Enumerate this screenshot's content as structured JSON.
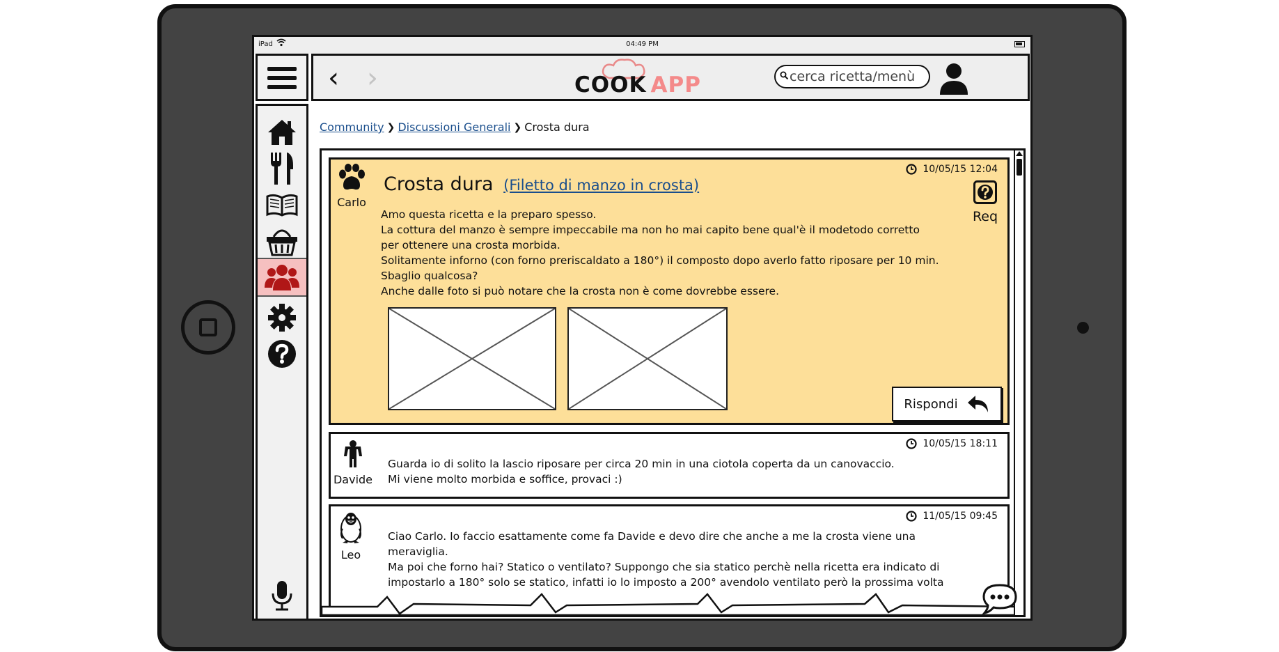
{
  "status_bar": {
    "carrier": "iPad",
    "time": "04:49 PM"
  },
  "logo": {
    "word1": "COOK",
    "word2": "APP"
  },
  "search": {
    "placeholder": "cerca ricetta/menù"
  },
  "breadcrumb": {
    "items": [
      "Community",
      "Discussioni Generali"
    ],
    "current": "Crosta dura"
  },
  "sidebar": {
    "items": [
      "home-icon",
      "cutlery-icon",
      "recipe-book-icon",
      "basket-icon",
      "community-icon",
      "settings-icon",
      "help-icon"
    ],
    "active": "community-icon",
    "bottom": "microphone-icon"
  },
  "thread": {
    "main_post": {
      "author": "Carlo",
      "avatar": "paw-icon",
      "timestamp": "10/05/15 12:04",
      "title": "Crosta dura",
      "recipe_link": "(Filetto di manzo in crosta)",
      "req_label": "Req",
      "body": [
        "Amo questa ricetta e la preparo spesso.",
        "La cottura del manzo è sempre impeccabile ma non ho mai capito bene qual'è il modetodo corretto",
        "per ottenere una crosta morbida.",
        "Solitamente inforno (con forno preriscaldato a 180°) il composto dopo averlo fatto riposare per 10 min.",
        "Sbaglio qualcosa?",
        "Anche dalle foto si può notare che la crosta non è come dovrebbe essere."
      ],
      "reply_label": "Rispondi"
    },
    "replies": [
      {
        "author": "Davide",
        "avatar": "person-icon",
        "timestamp": "10/05/15 18:11",
        "body": [
          "Guarda io di solito la lascio riposare per circa 20 min in una ciotola coperta da un canovaccio.",
          "Mi viene molto morbida e soffice, provaci :)"
        ]
      },
      {
        "author": "Leo",
        "avatar": "penguin-icon",
        "timestamp": "11/05/15 09:45",
        "body": [
          "Ciao Carlo. Io faccio esattamente come fa Davide e devo dire che anche a me la crosta viene una",
          "meraviglia.",
          "Ma poi che forno hai? Statico o ventilato? Suppongo che sia statico perchè nella ricetta era indicato di",
          "impostarlo a 180° solo se statico, infatti io lo imposto a 200° avendolo ventilato però la prossima volta"
        ]
      }
    ]
  },
  "colors": {
    "highlight_post": "#fddf99",
    "active_nav": "#f6c0c0",
    "logo_accent": "#f48a8a",
    "link": "#1a4e8c"
  }
}
